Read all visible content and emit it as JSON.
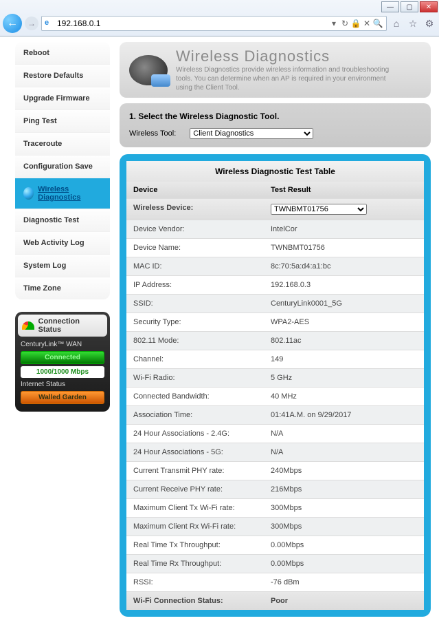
{
  "browser": {
    "url": "192.168.0.1"
  },
  "sidebar": {
    "items": [
      {
        "label": "Reboot"
      },
      {
        "label": "Restore Defaults"
      },
      {
        "label": "Upgrade Firmware"
      },
      {
        "label": "Ping Test"
      },
      {
        "label": "Traceroute"
      },
      {
        "label": "Configuration Save"
      },
      {
        "label": "Wireless Diagnostics"
      },
      {
        "label": "Diagnostic Test"
      },
      {
        "label": "Web Activity Log"
      },
      {
        "label": "System Log"
      },
      {
        "label": "Time Zone"
      }
    ],
    "active_index": 6
  },
  "status": {
    "title": "Connection Status",
    "wan_label": "CenturyLink™ WAN",
    "wan_state": "Connected",
    "speed": "1000/1000 Mbps",
    "inet_label": "Internet Status",
    "inet_state": "Walled Garden"
  },
  "header": {
    "title": "Wireless Diagnostics",
    "subtitle": "Wireless Diagnostics provide wireless information and troubleshooting tools. You can determine when an AP is required in your environment using the Client Tool."
  },
  "selector": {
    "step_title": "1. Select the Wireless Diagnostic Tool.",
    "label": "Wireless Tool:",
    "value": "Client Diagnostics"
  },
  "table": {
    "title": "Wireless Diagnostic Test Table",
    "col1": "Device",
    "col2": "Test Result",
    "device_row_label": "Wireless Device:",
    "device_select": "TWNBMT01756",
    "rows": [
      {
        "label": "Device Vendor:",
        "value": "IntelCor"
      },
      {
        "label": "Device Name:",
        "value": "TWNBMT01756"
      },
      {
        "label": "MAC ID:",
        "value": "8c:70:5a:d4:a1:bc"
      },
      {
        "label": "IP Address:",
        "value": "192.168.0.3"
      },
      {
        "label": "SSID:",
        "value": "CenturyLink0001_5G"
      },
      {
        "label": "Security Type:",
        "value": "WPA2-AES"
      },
      {
        "label": "802.11 Mode:",
        "value": "802.11ac"
      },
      {
        "label": "Channel:",
        "value": "149"
      },
      {
        "label": "Wi-Fi Radio:",
        "value": "5 GHz"
      },
      {
        "label": "Connected Bandwidth:",
        "value": "40 MHz"
      },
      {
        "label": "Association Time:",
        "value": "01:41A.M. on 9/29/2017"
      },
      {
        "label": "24 Hour Associations - 2.4G:",
        "value": "N/A"
      },
      {
        "label": "24 Hour Associations - 5G:",
        "value": "N/A"
      },
      {
        "label": "Current Transmit PHY rate:",
        "value": "240Mbps"
      },
      {
        "label": "Current Receive PHY rate:",
        "value": "216Mbps"
      },
      {
        "label": "Maximum Client Tx Wi-Fi rate:",
        "value": "300Mbps"
      },
      {
        "label": "Maximum Client Rx Wi-Fi rate:",
        "value": "300Mbps"
      },
      {
        "label": "Real Time Tx Throughput:",
        "value": "0.00Mbps"
      },
      {
        "label": "Real Time Rx Throughput:",
        "value": "0.00Mbps"
      },
      {
        "label": "RSSI:",
        "value": "-76 dBm"
      }
    ],
    "footer": {
      "label": "Wi-Fi Connection Status:",
      "value": "Poor"
    }
  }
}
